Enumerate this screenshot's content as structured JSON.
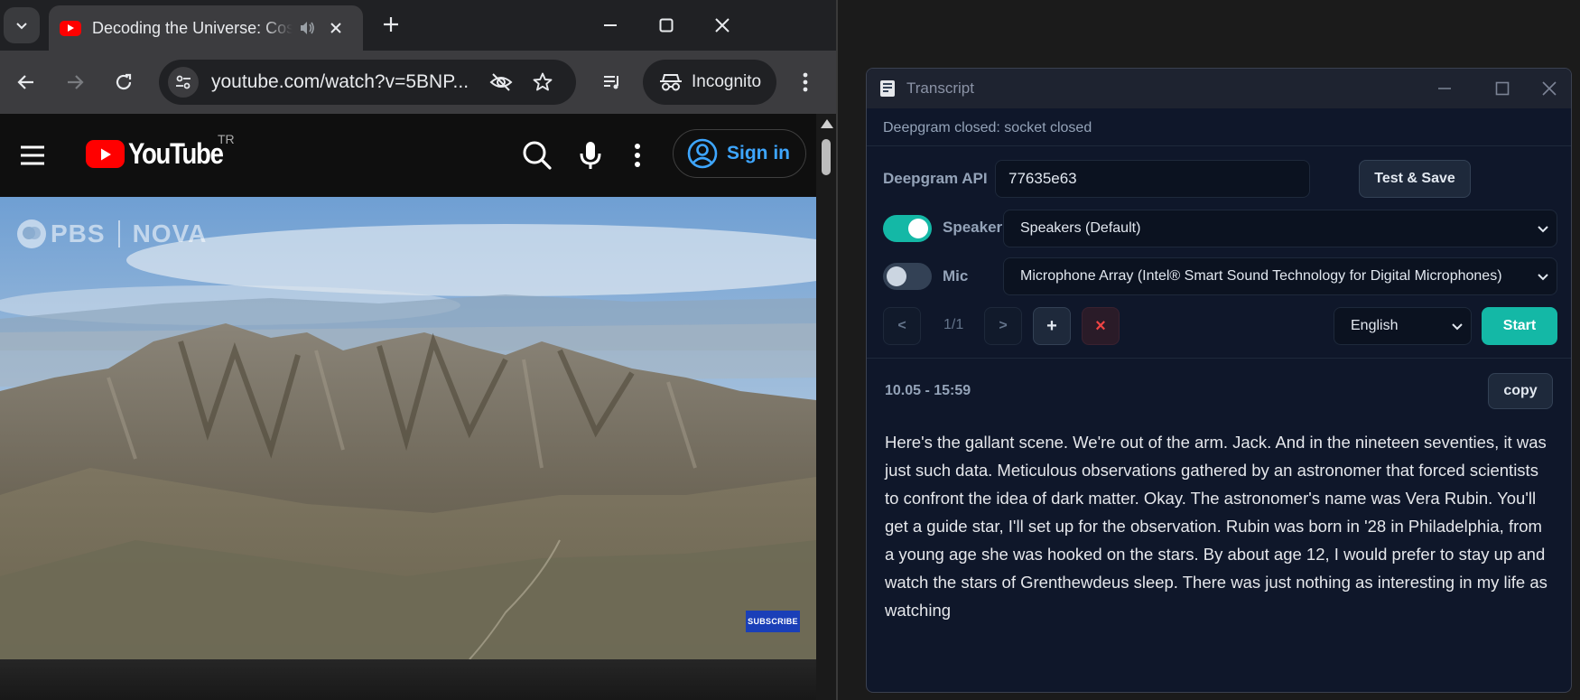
{
  "browser": {
    "tab": {
      "title": "Decoding the Universe: Cosmology | NOVA"
    },
    "address": {
      "url": "youtube.com/watch?v=5BNP..."
    },
    "incognito_label": "Incognito"
  },
  "youtube": {
    "logo_text": "YouTube",
    "country_code": "TR",
    "signin_label": "Sign in",
    "video": {
      "watermark_left": "PBS",
      "watermark_right": "NOVA",
      "subscribe_label": "SUBSCRIBE"
    }
  },
  "transcript": {
    "window_title": "Transcript",
    "status": "Deepgram closed: socket closed",
    "api": {
      "label": "Deepgram API",
      "value": "77635e63",
      "save_label": "Test & Save"
    },
    "speaker": {
      "label": "Speaker",
      "enabled": true,
      "device": "Speakers (Default)"
    },
    "mic": {
      "label": "Mic",
      "enabled": false,
      "device": "Microphone Array (Intel® Smart Sound Technology for Digital Microphones)"
    },
    "controls": {
      "prev_label": "<",
      "page": "1/1",
      "next_label": ">",
      "add_label": "+",
      "delete_label": "×",
      "language": "English",
      "start_label": "Start"
    },
    "entry": {
      "time": "10.05 - 15:59",
      "copy_label": "copy",
      "text": "Here's the gallant scene. We're out of the arm. Jack. And in the nineteen seventies, it was just such data. Meticulous observations gathered by an astronomer that forced scientists to confront the idea of dark matter. Okay. The astronomer's name was Vera Rubin. You'll get a guide star, I'll set up for the observation. Rubin was born in '28 in Philadelphia, from a young age she was hooked on the stars. By about age 12, I would prefer to stay up and watch the stars of Grenthewdeus sleep. There was just nothing as interesting in my life as watching"
    }
  },
  "colors": {
    "accent_teal": "#14b8a6",
    "youtube_red": "#ff0000",
    "link_blue": "#3ea6ff",
    "danger_red": "#ef4444"
  }
}
